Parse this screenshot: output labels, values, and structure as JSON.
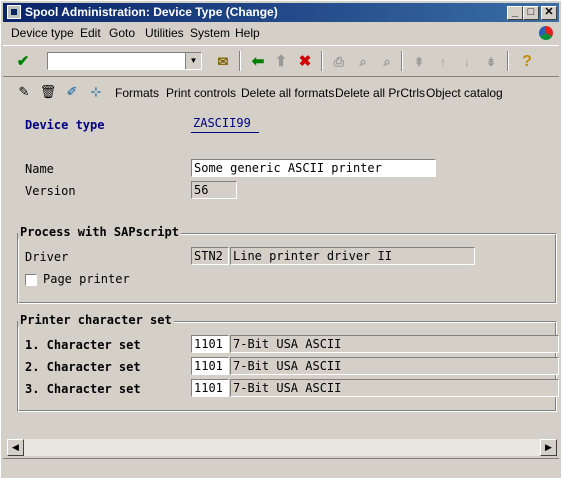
{
  "window": {
    "title": "Spool Administration: Device Type (Change)",
    "minimize": "_",
    "maximize": "□",
    "close": "✕"
  },
  "menu": {
    "items": [
      "Device type",
      "Edit",
      "Goto",
      "Utilities",
      "System",
      "Help"
    ]
  },
  "toolbar": {
    "command_value": ""
  },
  "toolbar2": {
    "buttons": [
      "Formats",
      "Print controls",
      "Delete all formats",
      "Delete all PrCtrls",
      "Object catalog"
    ]
  },
  "form": {
    "device_type_label": "Device type",
    "device_type_value": "ZASCII99",
    "name_label": "Name",
    "name_value": "Some generic ASCII printer",
    "version_label": "Version",
    "version_value": "56",
    "process_group_title": "Process with SAPscript",
    "driver_label": "Driver",
    "driver_code": "STN2",
    "driver_desc": "Line printer driver II",
    "page_printer_label": "Page printer",
    "page_printer_checked": false,
    "charset_group_title": "Printer character set",
    "charsets": [
      {
        "label": "1.  Character set",
        "code": "1101",
        "desc": "7-Bit USA ASCII"
      },
      {
        "label": "2.  Character set",
        "code": "1101",
        "desc": "7-Bit USA ASCII"
      },
      {
        "label": "3.  Character set",
        "code": "1101",
        "desc": "7-Bit USA ASCII"
      }
    ]
  },
  "colors": {
    "titlebar": "#0a246a",
    "label_blue": "#000080",
    "face": "#d4d0c8"
  }
}
